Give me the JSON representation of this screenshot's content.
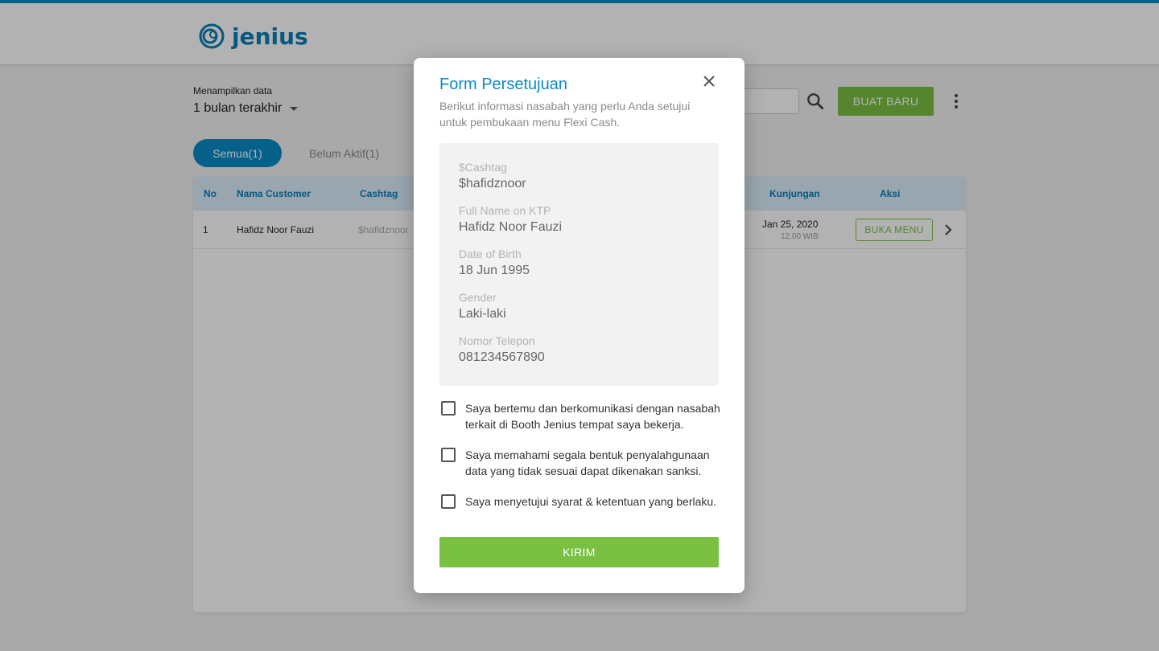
{
  "header": {
    "logo_text": "jenius",
    "accent": "#0a8bc6"
  },
  "filter": {
    "label": "Menampilkan data",
    "value": "1 bulan terakhir"
  },
  "toolbar": {
    "new_label": "BUAT BARU",
    "search_icon": "search-icon",
    "more_icon": "more-vert-icon"
  },
  "tabs": [
    {
      "label": "Semua(1)",
      "active": true
    },
    {
      "label": "Belum Aktif(1)",
      "active": false
    }
  ],
  "table": {
    "headers": {
      "no": "No",
      "name": "Nama Customer",
      "cashtag": "Cashtag",
      "visit": "Kunjungan",
      "action": "Aksi"
    },
    "rows": [
      {
        "no": "1",
        "name": "Hafidz Noor Fauzi",
        "cashtag": "$hafidznoor",
        "date": "Jan 25, 2020",
        "time": "12.00 WIB",
        "action_label": "BUKA MENU"
      }
    ]
  },
  "modal": {
    "title": "Form Persetujuan",
    "subtitle": "Berikut informasi nasabah yang perlu Anda setujui untuk pembukaan menu Flexi Cash.",
    "fields": [
      {
        "label": "$Cashtag",
        "value": "$hafidznoor"
      },
      {
        "label": "Full Name on KTP",
        "value": "Hafidz Noor Fauzi"
      },
      {
        "label": "Date of Birth",
        "value": "18 Jun 1995"
      },
      {
        "label": "Gender",
        "value": "Laki-laki"
      },
      {
        "label": "Nomor Telepon",
        "value": "081234567890"
      }
    ],
    "checks": [
      {
        "text": "Saya bertemu dan berkomunikasi dengan nasabah terkait di Booth Jenius tempat saya bekerja.",
        "checked": false
      },
      {
        "text": "Saya memahami segala bentuk penyalahgunaan data yang tidak sesuai dapat dikenakan sanksi.",
        "checked": false
      },
      {
        "text": "Saya menyetujui syarat & ketentuan yang berlaku.",
        "checked": false
      }
    ],
    "submit_label": "KIRIM",
    "submit_color": "#7ac143"
  }
}
